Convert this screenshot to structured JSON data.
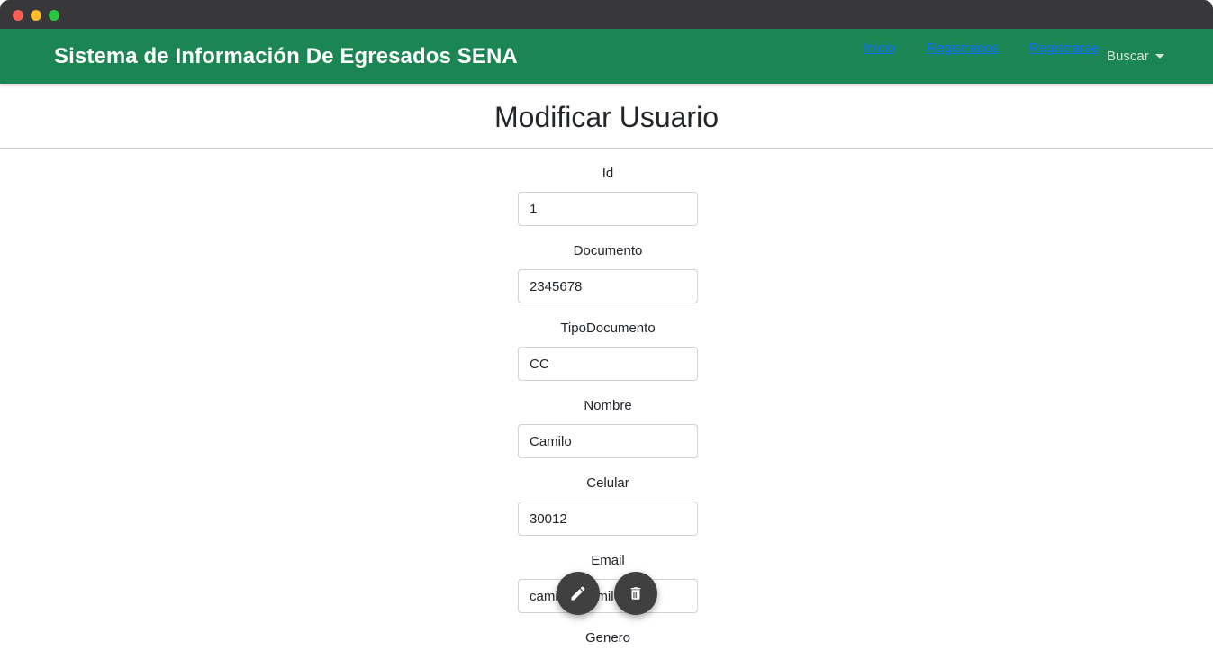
{
  "navbar": {
    "brand": "Sistema de Información De Egresados SENA",
    "links": [
      "Inicio",
      "Registrados",
      "Registrarse"
    ],
    "dropdown_label": "Buscar"
  },
  "page": {
    "title": "Modificar Usuario"
  },
  "form": {
    "fields": [
      {
        "label": "Id",
        "value": "1"
      },
      {
        "label": "Documento",
        "value": "2345678"
      },
      {
        "label": "TipoDocumento",
        "value": "CC"
      },
      {
        "label": "Nombre",
        "value": "Camilo"
      },
      {
        "label": "Celular",
        "value": "30012"
      },
      {
        "label": "Email",
        "value": "camilo@camilo.com"
      },
      {
        "label": "Genero",
        "value": ""
      }
    ]
  },
  "actions": {
    "edit_icon": "pencil-icon",
    "delete_icon": "trash-icon"
  },
  "colors": {
    "navbar": "#1b8553",
    "fab": "#404040",
    "link": "#0d6efd"
  }
}
